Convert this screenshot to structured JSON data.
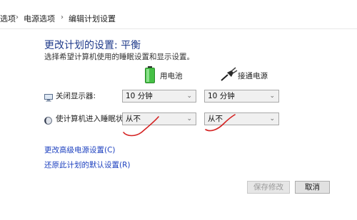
{
  "breadcrumb": {
    "items": [
      "选项",
      "电源选项",
      "编辑计划设置"
    ]
  },
  "header": {
    "title": "更改计划的设置: 平衡",
    "subtitle": "选择希望计算机使用的睡眠设置和显示设置。"
  },
  "columns": {
    "battery_label": "用电池",
    "plugged_label": "接通电源"
  },
  "settings": [
    {
      "label": "关闭显示器:",
      "battery_value": "10 分钟",
      "plugged_value": "10 分钟"
    },
    {
      "label": "使计算机进入睡眠状态:",
      "battery_value": "从不",
      "plugged_value": "从不"
    }
  ],
  "links": {
    "advanced": "更改高级电源设置(C)",
    "restore": "还原此计划的默认设置(R)"
  },
  "buttons": {
    "save": "保存修改",
    "cancel": "取消"
  },
  "colors": {
    "title": "#1f3a8a",
    "link": "#1b3fbf",
    "annotation": "#d42020",
    "battery": "#3cae3c"
  }
}
